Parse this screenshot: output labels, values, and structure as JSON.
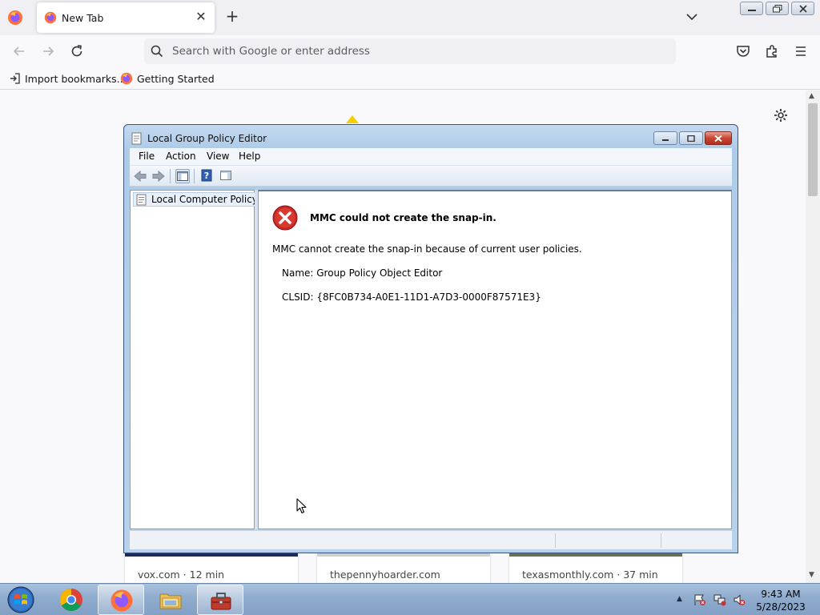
{
  "browser": {
    "tab": {
      "title": "New Tab"
    },
    "urlbar": {
      "placeholder": "Search with Google or enter address"
    },
    "bookmarks": [
      {
        "label": "Import bookmarks..."
      },
      {
        "label": "Getting Started"
      }
    ]
  },
  "newtab": {
    "cards": [
      {
        "label": "vox.com · 12 min"
      },
      {
        "label": "thepennyhoarder.com"
      },
      {
        "label": "texasmonthly.com · 37 min"
      }
    ]
  },
  "mmc": {
    "title": "Local Group Policy Editor",
    "menu": [
      "File",
      "Action",
      "View",
      "Help"
    ],
    "tree": {
      "root": "Local Computer Policy"
    },
    "error": {
      "title": "MMC could not create the snap-in.",
      "message": "MMC cannot create the snap-in because of current user policies.",
      "name": "Name: Group Policy Object Editor",
      "clsid": "CLSID: {8FC0B734-A0E1-11D1-A7D3-0000F87571E3}"
    }
  },
  "taskbar": {
    "apps": [
      "chrome",
      "firefox",
      "file-explorer",
      "toolbox"
    ],
    "clock": {
      "time": "9:43 AM",
      "date": "5/28/2023"
    }
  }
}
